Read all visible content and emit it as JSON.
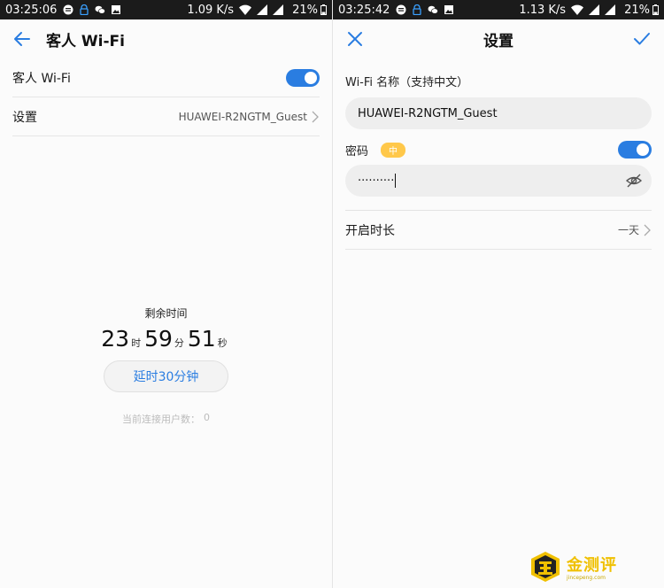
{
  "left": {
    "status": {
      "time": "03:25:06",
      "speed": "1.09 K/s",
      "battery": "21%"
    },
    "header": {
      "title": "客人 Wi-Fi"
    },
    "guest_wifi": {
      "label": "客人 Wi-Fi",
      "enabled": true
    },
    "settings": {
      "label": "设置",
      "value": "HUAWEI-R2NGTM_Guest"
    },
    "timer": {
      "caption": "剩余时间",
      "hours": "23",
      "hours_unit": "时",
      "minutes": "59",
      "minutes_unit": "分",
      "seconds": "51",
      "seconds_unit": "秒"
    },
    "extend_button": "延时30分钟",
    "users": {
      "label": "当前连接用户数：",
      "count": "0"
    }
  },
  "right": {
    "status": {
      "time": "03:25:42",
      "speed": "1.13 K/s",
      "battery": "21%"
    },
    "header": {
      "title": "设置"
    },
    "wifi_name": {
      "label": "Wi-Fi 名称（支持中文）",
      "value": "HUAWEI-R2NGTM_Guest"
    },
    "password": {
      "label": "密码",
      "strength": "中",
      "enabled": true,
      "masked_value": "··········"
    },
    "duration": {
      "label": "开启时长",
      "value": "一天"
    }
  },
  "watermark": {
    "text": "金测评",
    "subtext": "jincepeng.com"
  },
  "colors": {
    "accent": "#2a7de1",
    "strength_badge": "#ffc84a",
    "watermark": "#f0c000"
  }
}
